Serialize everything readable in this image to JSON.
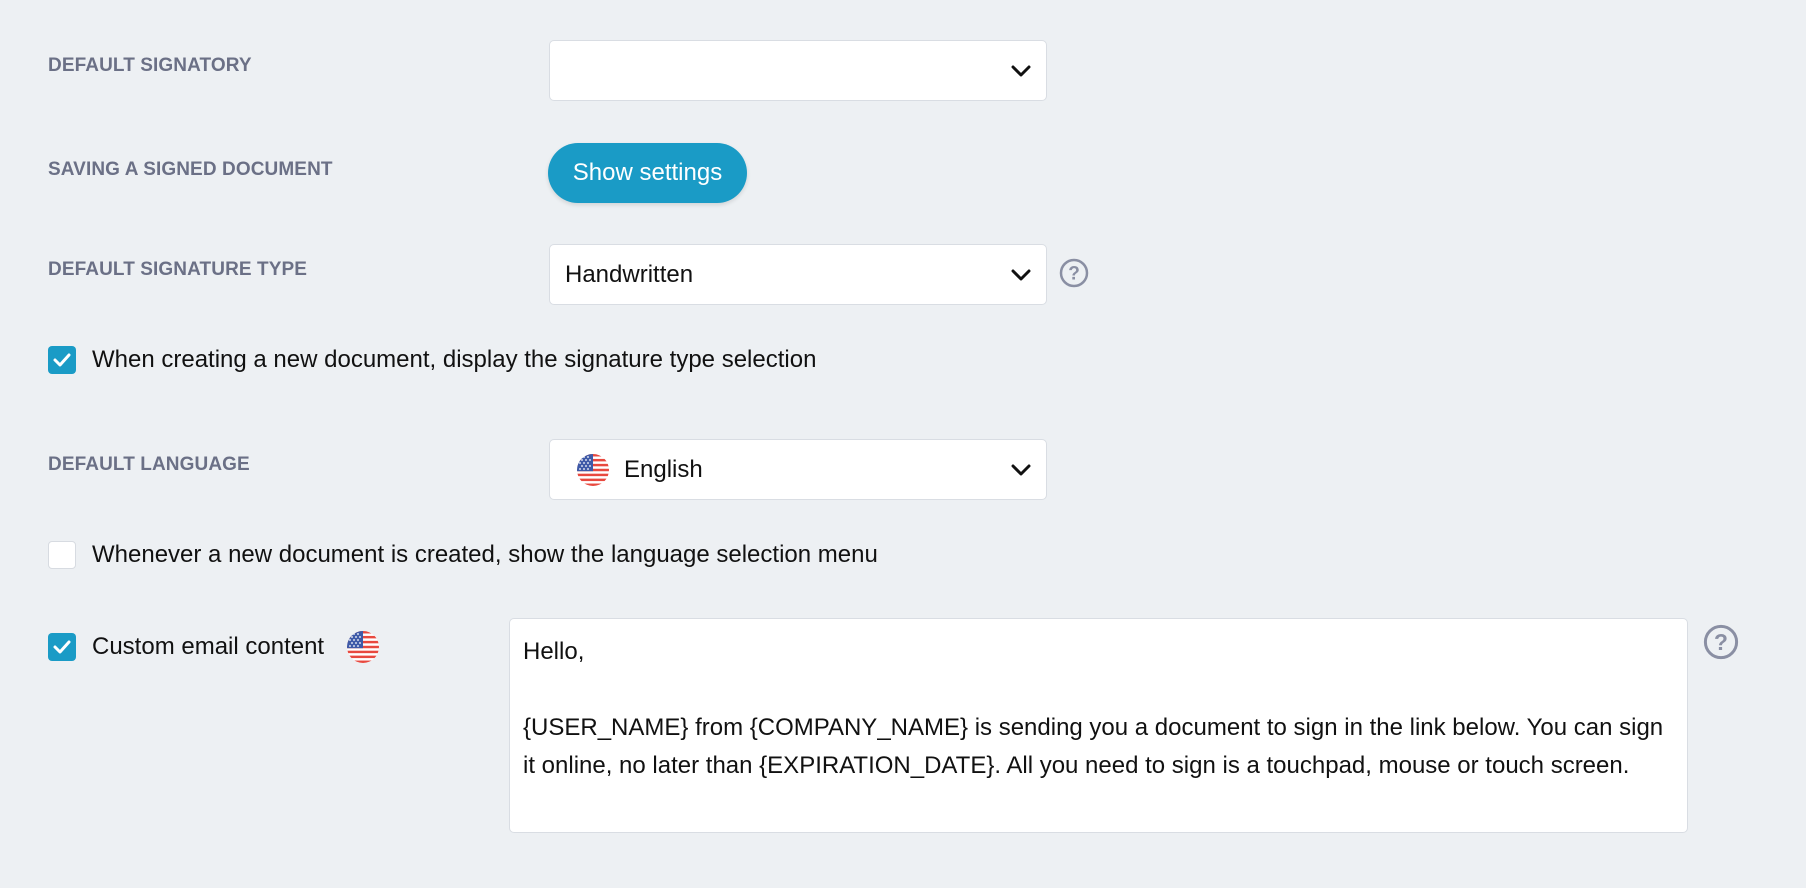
{
  "default_signatory": {
    "label": "DEFAULT SIGNATORY",
    "value": ""
  },
  "saving_signed_document": {
    "label": "SAVING A SIGNED DOCUMENT",
    "button_label": "Show settings"
  },
  "default_signature_type": {
    "label": "DEFAULT SIGNATURE TYPE",
    "value": "Handwritten"
  },
  "display_signature_type_selection": {
    "checked": true,
    "label": "When creating a new document, display the signature type selection"
  },
  "default_language": {
    "label": "DEFAULT LANGUAGE",
    "value": "English",
    "flag_icon": "us-flag-icon"
  },
  "show_language_selection_menu": {
    "checked": false,
    "label": "Whenever a new document is created, show the language selection menu"
  },
  "custom_email_content": {
    "checked": true,
    "label": "Custom email content",
    "flag_icon": "us-flag-icon",
    "greeting": "Hello,",
    "body": "{USER_NAME} from {COMPANY_NAME} is sending you a document to sign in the link below. You can sign it online, no later than {EXPIRATION_DATE}. All you need to sign is a touchpad, mouse or touch screen."
  },
  "colors": {
    "background": "#edf0f3",
    "accent": "#1a9bc6",
    "label": "#6b7086",
    "help_icon": "#8a8fa3"
  }
}
